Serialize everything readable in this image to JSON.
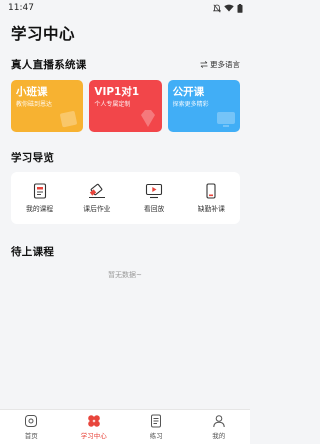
{
  "status_bar": {
    "time": "11:47"
  },
  "page": {
    "title": "学习中心"
  },
  "live_section": {
    "title": "真人直播系统课",
    "more_link": "更多语言",
    "cards": [
      {
        "title": "小班课",
        "subtitle": "教你磁到恩达",
        "color": "#f7b231"
      },
      {
        "title": "VIP1对1",
        "subtitle": "个人专属定制",
        "color": "#f2464a"
      },
      {
        "title": "公开课",
        "subtitle": "探索更多精彩",
        "color": "#41aef6"
      }
    ]
  },
  "guide_section": {
    "title": "学习导览",
    "items": [
      {
        "label": "我的课程",
        "icon": "course-book-icon"
      },
      {
        "label": "课后作业",
        "icon": "eraser-icon"
      },
      {
        "label": "看回放",
        "icon": "playback-icon"
      },
      {
        "label": "缺勤补课",
        "icon": "phone-icon"
      }
    ]
  },
  "upcoming_section": {
    "title": "待上课程",
    "empty_text": "暂无数据~"
  },
  "tab_bar": {
    "tabs": [
      {
        "label": "首页",
        "icon": "home-icon",
        "active": false
      },
      {
        "label": "学习中心",
        "icon": "clover-icon",
        "active": true
      },
      {
        "label": "练习",
        "icon": "practice-icon",
        "active": false
      },
      {
        "label": "我的",
        "icon": "user-icon",
        "active": false
      }
    ],
    "active_color": "#e8453c"
  }
}
